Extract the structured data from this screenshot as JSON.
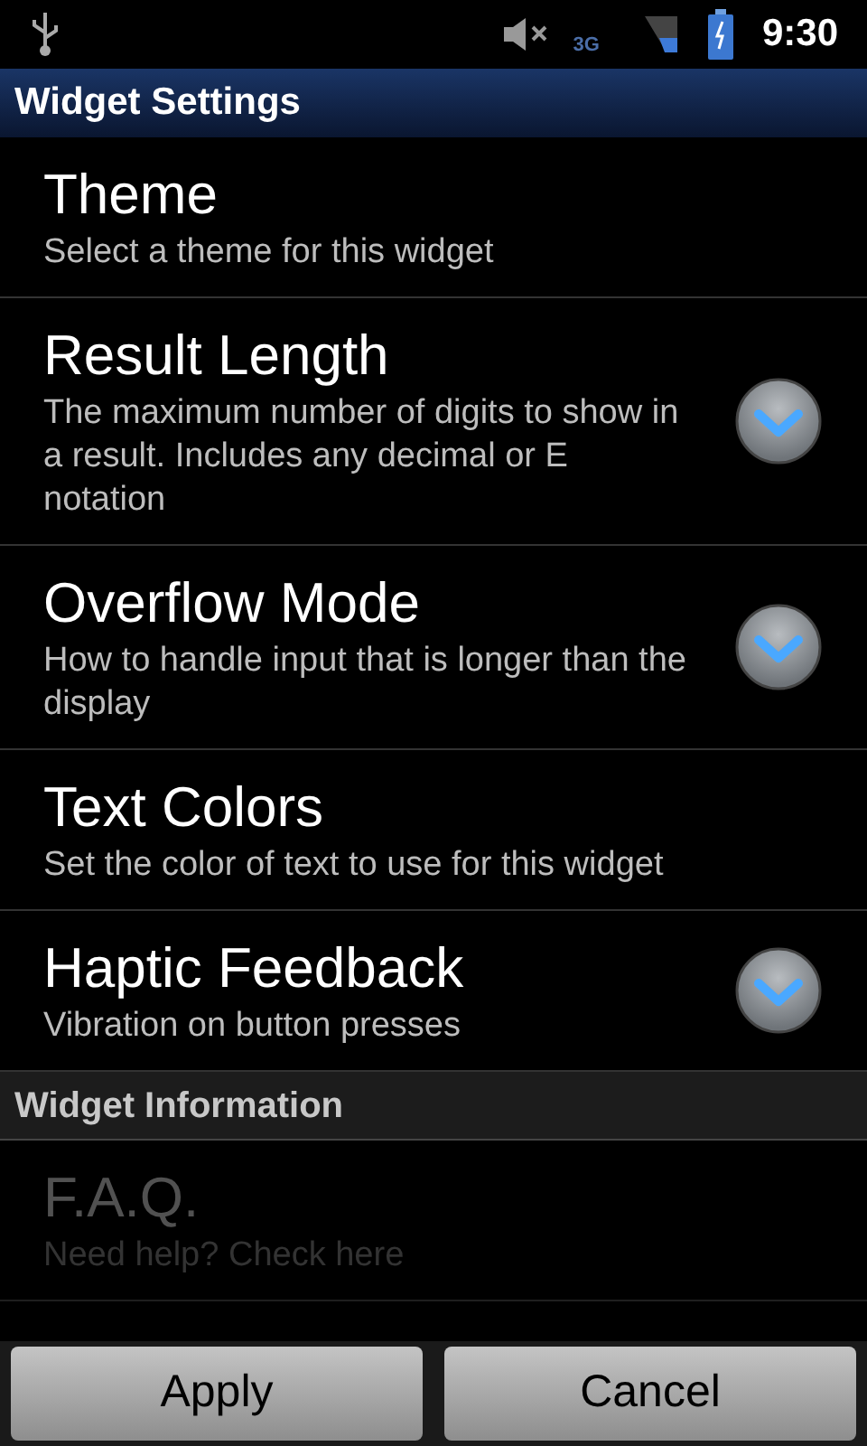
{
  "status_bar": {
    "time": "9:30",
    "network": "3G"
  },
  "title_bar": {
    "title": "Widget Settings"
  },
  "sections": [
    {
      "items": [
        {
          "title": "Theme",
          "summary": "Select a theme for this widget",
          "kind": "plain",
          "disabled": false
        },
        {
          "title": "Result Length",
          "summary": "The maximum number of digits to show in a result. Includes any decimal or E notation",
          "kind": "list",
          "disabled": false
        },
        {
          "title": "Overflow Mode",
          "summary": "How to handle input that is longer than the display",
          "kind": "list",
          "disabled": false
        },
        {
          "title": "Text Colors",
          "summary": "Set the color of text to use for this widget",
          "kind": "plain",
          "disabled": false
        },
        {
          "title": "Haptic Feedback",
          "summary": "Vibration on button presses",
          "kind": "list",
          "disabled": false
        }
      ]
    },
    {
      "header": "Widget Information",
      "items": [
        {
          "title": "F.A.Q.",
          "summary": "Need help? Check here",
          "kind": "plain",
          "disabled": true
        }
      ]
    }
  ],
  "buttons": [
    "Apply",
    "Cancel"
  ]
}
